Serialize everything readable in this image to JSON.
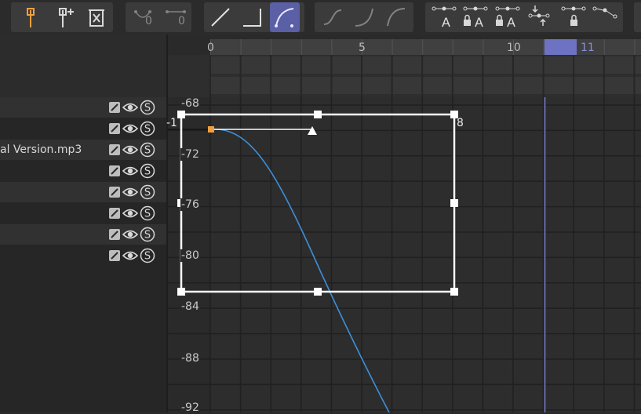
{
  "toolbar": {
    "groups": [
      {
        "name": "marker-group",
        "buttons": [
          {
            "icon": "add-marker-icon",
            "badge": "",
            "active": false,
            "dim": false
          },
          {
            "icon": "add-marker-plus-icon",
            "badge": "",
            "active": false,
            "dim": false
          },
          {
            "icon": "delete-marker-icon",
            "badge": "",
            "active": false,
            "dim": false
          }
        ]
      },
      {
        "name": "counter-group",
        "buttons": [
          {
            "icon": "bezier-count-icon",
            "badge": "0",
            "active": false,
            "dim": true
          },
          {
            "icon": "hold-count-icon",
            "badge": "0",
            "active": false,
            "dim": true
          }
        ]
      },
      {
        "name": "interpolation-group",
        "buttons": [
          {
            "icon": "linear-interpolation-icon",
            "badge": "",
            "active": false,
            "dim": false
          },
          {
            "icon": "step-interpolation-icon",
            "badge": "",
            "active": false,
            "dim": false
          },
          {
            "icon": "bezier-interpolation-icon",
            "badge": "",
            "active": true,
            "dim": false
          }
        ]
      },
      {
        "name": "ease-group",
        "buttons": [
          {
            "icon": "ease-in-out-icon",
            "badge": "",
            "active": false,
            "dim": true
          },
          {
            "icon": "ease-in-icon",
            "badge": "",
            "active": false,
            "dim": true
          },
          {
            "icon": "ease-out-icon",
            "badge": "",
            "active": false,
            "dim": true
          }
        ]
      },
      {
        "name": "key-tools-group",
        "buttons": [
          {
            "icon": "auto-tangent-icon",
            "badge": "A",
            "active": false,
            "dim": false
          },
          {
            "icon": "lock-tangent-auto-icon",
            "badge": "A",
            "active": false,
            "dim": false
          },
          {
            "icon": "lock-auto-icon",
            "badge": "A",
            "active": false,
            "dim": false
          },
          {
            "icon": "align-keys-icon",
            "badge": "",
            "active": false,
            "dim": false
          },
          {
            "icon": "lock-key-icon",
            "badge": "",
            "active": false,
            "dim": false
          },
          {
            "icon": "break-tangent-icon",
            "badge": "",
            "active": false,
            "dim": false
          }
        ]
      }
    ]
  },
  "tracks": [
    {
      "name": ""
    },
    {
      "name": ""
    },
    {
      "name": "al Version.mp3"
    },
    {
      "name": ""
    },
    {
      "name": ""
    },
    {
      "name": ""
    },
    {
      "name": ""
    },
    {
      "name": ""
    }
  ],
  "ruler": {
    "labels": [
      "0",
      "5",
      "10"
    ],
    "playhead_label": "11"
  },
  "graph": {
    "value_labels": [
      "-68",
      "-72",
      "-76",
      "-80",
      "-84",
      "-88",
      "-92"
    ],
    "frame_start": "-1",
    "frame_end": "8"
  },
  "colors": {
    "accent": "#5b5fa5",
    "playhead": "#6e72c2",
    "curve": "#3d8fd8",
    "key": "#f0a040"
  }
}
